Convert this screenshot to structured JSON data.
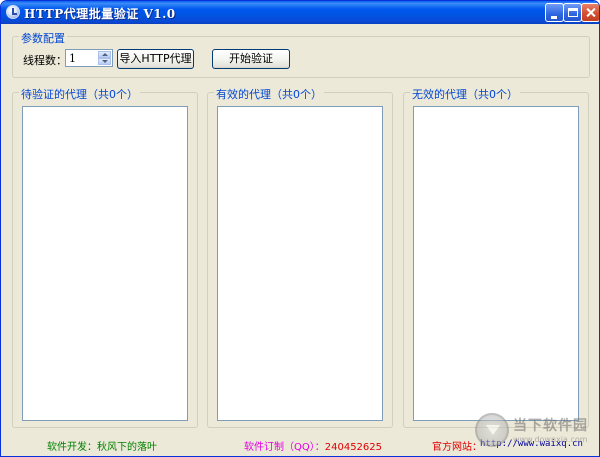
{
  "window": {
    "title": "HTTP代理批量验证 V1.0",
    "icon": "app-icon"
  },
  "params": {
    "group_title": "参数配置",
    "threads_label": "线程数：",
    "threads_value": "1",
    "import_button": "导入HTTP代理",
    "start_button": "开始验证"
  },
  "lists": {
    "pending_title": "待验证的代理（共0个）",
    "valid_title": "有效的代理（共0个）",
    "invalid_title": "无效的代理（共0个）"
  },
  "footer": {
    "developer": "软件开发：秋风下的落叶",
    "custom_label": "软件订制（QQ）：",
    "custom_qq": "240452625",
    "site_label": "官方网站：",
    "site_url": "http://www.waixq.cn"
  },
  "watermark": {
    "brand": "当下软件园",
    "url": "www.downxia.com"
  },
  "colors": {
    "titlebar": "#0054e3",
    "group_title": "#0046d5",
    "developer": "#008000",
    "custom": "#e000e0",
    "site": "#e00000"
  }
}
